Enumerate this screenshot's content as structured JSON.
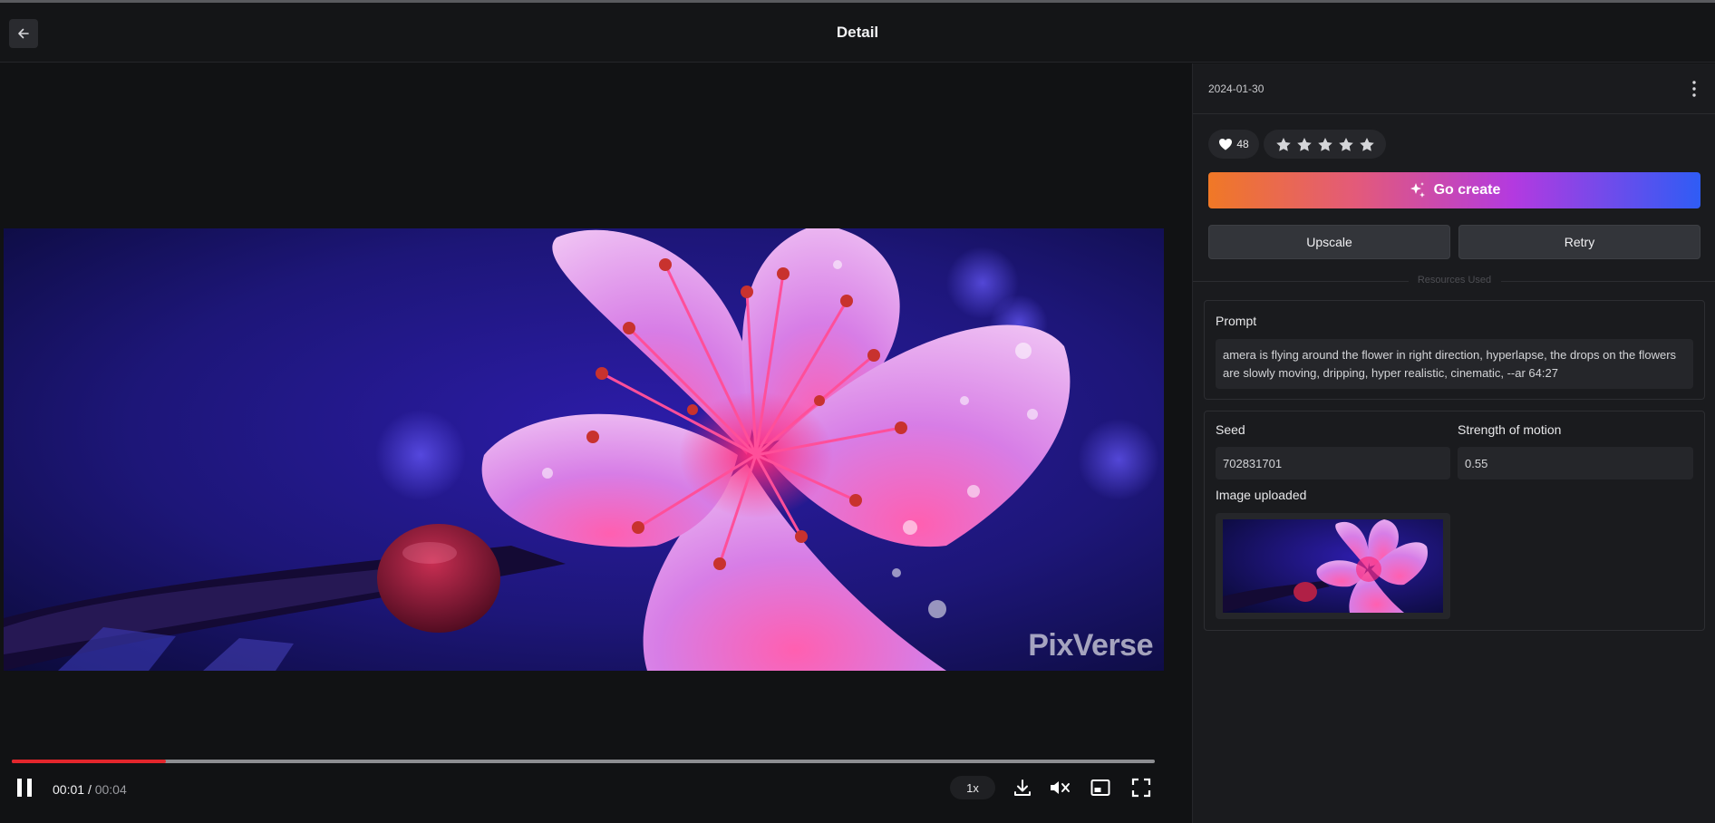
{
  "header": {
    "title": "Detail",
    "back_icon": "arrow-left-icon"
  },
  "player": {
    "watermark": "PixVerse",
    "current_time": "00:01",
    "separator": "/",
    "duration": "00:04",
    "progress": 0.135,
    "speed": "1x",
    "state": "playing",
    "muted": true,
    "colors": {
      "progress_played": "#e3262c",
      "progress_track": "#8d8e92"
    }
  },
  "sidebar": {
    "date": "2024-01-30",
    "likes": "48",
    "rating": {
      "max": 5,
      "value": 5
    },
    "go_create_label": "Go create",
    "upscale_label": "Upscale",
    "retry_label": "Retry",
    "resources_label": "Resources Used",
    "prompt_label": "Prompt",
    "prompt_text": "amera is flying around the flower in right direction, hyperlapse, the drops on the flowers are slowly moving, dripping, hyper realistic, cinematic, --ar 64:27",
    "seed_label": "Seed",
    "seed_value": "702831701",
    "strength_label": "Strength of motion",
    "strength_value": "0.55",
    "image_uploaded_label": "Image uploaded",
    "colors": {
      "gradient": [
        "#f07826",
        "#e35a7a",
        "#b33ae0",
        "#2f5cf5"
      ]
    }
  }
}
